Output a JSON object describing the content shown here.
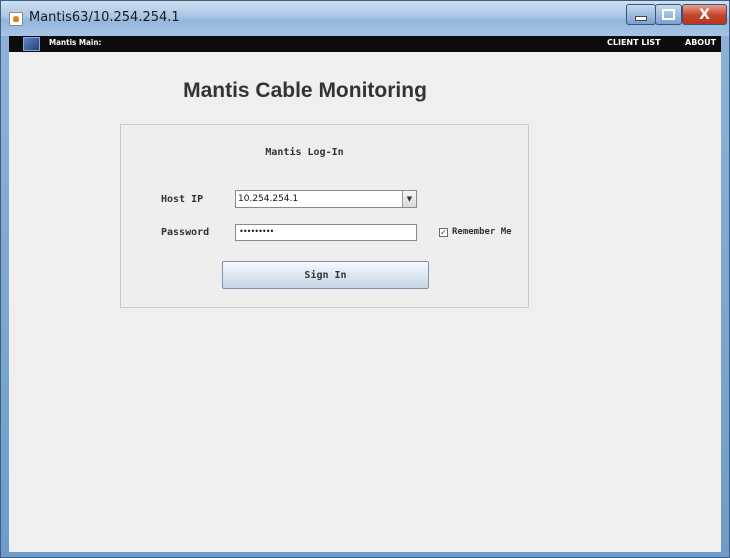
{
  "window": {
    "title": "Mantis63/10.254.254.1",
    "close_glyph": "X"
  },
  "menubar": {
    "app_name": "Mantis Main:",
    "items": [
      "CLIENT LIST",
      "ABOUT"
    ]
  },
  "main": {
    "heading": "Mantis Cable Monitoring"
  },
  "login": {
    "title": "Mantis Log-In",
    "host_label": "Host IP",
    "host_value": "10.254.254.1",
    "password_label": "Password",
    "password_masked": "•••••••••",
    "remember_label": "Remember Me",
    "remember_checked": true,
    "signin_label": "Sign In"
  },
  "icons": {
    "app": "java-cup-icon",
    "menu_logo": "mantis-logo-icon",
    "dropdown": "chevron-down-icon"
  }
}
